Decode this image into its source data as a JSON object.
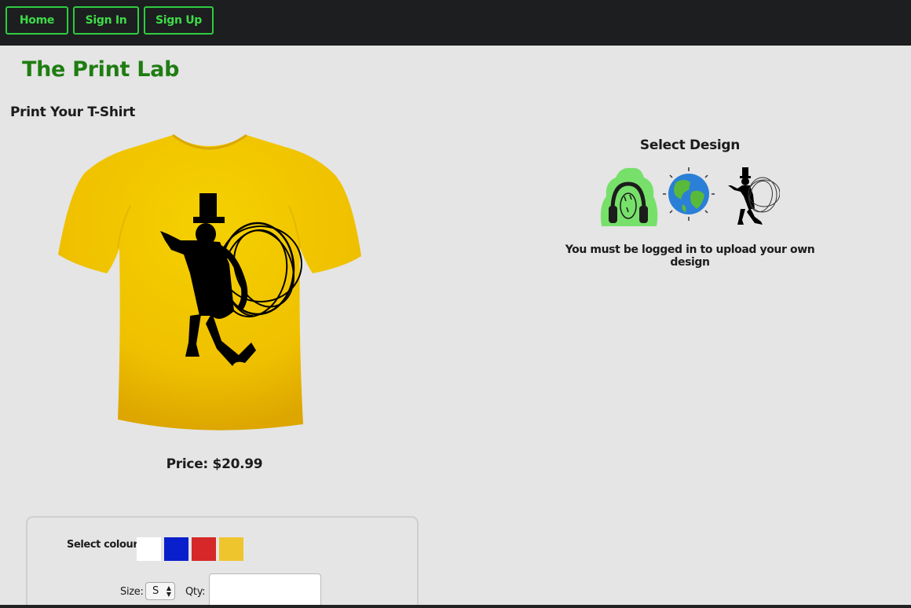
{
  "nav": {
    "home_label": "Home",
    "signin_label": "Sign In",
    "signup_label": "Sign Up"
  },
  "brand": {
    "title": "The Print Lab"
  },
  "editor": {
    "heading": "Print Your T-Shirt",
    "price_text": "Price: $20.99",
    "shirt_color": "#f1c40f"
  },
  "designs": {
    "heading": "Select Design",
    "items": [
      {
        "icon": "headphones-design-icon"
      },
      {
        "icon": "globe-design-icon"
      },
      {
        "icon": "dancer-design-icon"
      }
    ],
    "login_note": "You must be logged in to upload your own design"
  },
  "options": {
    "colour_label": "Select colour:",
    "colours": [
      "#ffffff",
      "#0a1fcc",
      "#d62828",
      "#efc52d"
    ],
    "size_label": "Size:",
    "size_value": "S",
    "qty_label": "Qty:",
    "qty_value": ""
  },
  "colors": {
    "accent": "#2ecc40",
    "brand": "#1f7d12",
    "nav_bg": "#1d1e20"
  }
}
